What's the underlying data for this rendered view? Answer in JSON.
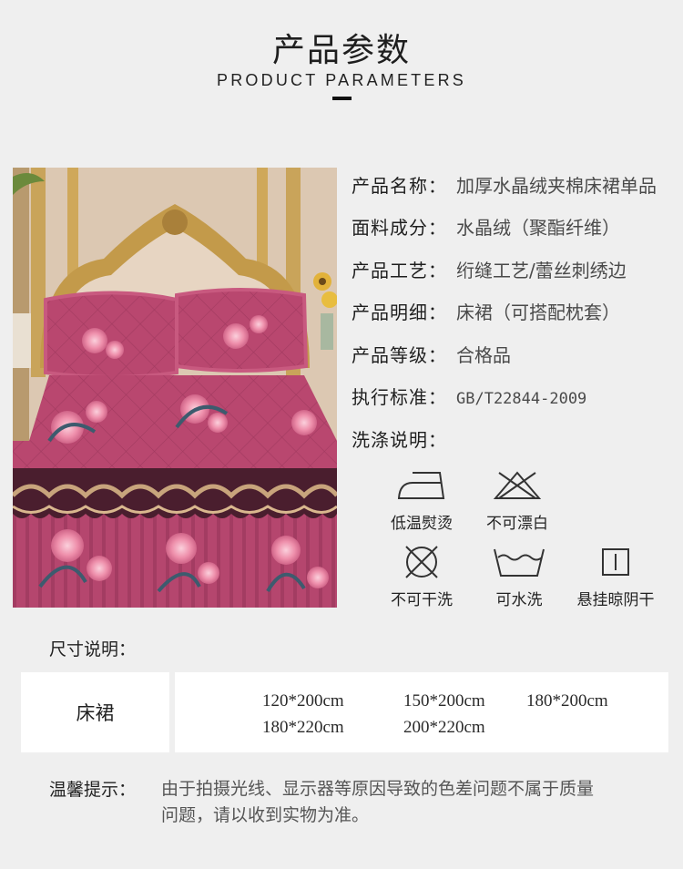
{
  "header": {
    "title_cn": "产品参数",
    "title_en": "PRODUCT PARAMETERS"
  },
  "photo": {
    "subject": "bed-skirt-photo",
    "colors": {
      "fabric": "#b84a72",
      "lace": "#4a1e2e",
      "wall": "#d8c2a8",
      "gold": "#c39a4a"
    }
  },
  "params": [
    {
      "label": "产品名称：",
      "value": "加厚水晶绒夹棉床裙单品"
    },
    {
      "label": "面料成分：",
      "value": "水晶绒（聚酯纤维）"
    },
    {
      "label": "产品工艺：",
      "value": "绗缝工艺/蕾丝刺绣边"
    },
    {
      "label": "产品明细：",
      "value": "床裙（可搭配枕套）"
    },
    {
      "label": "产品等级：",
      "value": "合格品"
    },
    {
      "label": "执行标准：",
      "value": "GB/T22844-2009"
    },
    {
      "label": "洗涤说明：",
      "value": ""
    }
  ],
  "care": [
    {
      "icon": "iron-low-icon",
      "label": "低温熨烫"
    },
    {
      "icon": "no-bleach-icon",
      "label": "不可漂白"
    },
    {
      "icon": "no-dry-clean-icon",
      "label": "不可干洗"
    },
    {
      "icon": "washable-icon",
      "label": "可水洗"
    },
    {
      "icon": "hang-dry-shade-icon",
      "label": "悬挂晾阴干"
    }
  ],
  "size": {
    "heading": "尺寸说明：",
    "product": "床裙",
    "sizes": [
      "120*200cm",
      "150*200cm",
      "180*200cm",
      "180*220cm",
      "200*220cm"
    ]
  },
  "tip": {
    "label": "温馨提示：",
    "text_line1": "由于拍摄光线、显示器等原因导致的色差问题不属于质量",
    "text_line2": "问题，请以收到实物为准。"
  }
}
